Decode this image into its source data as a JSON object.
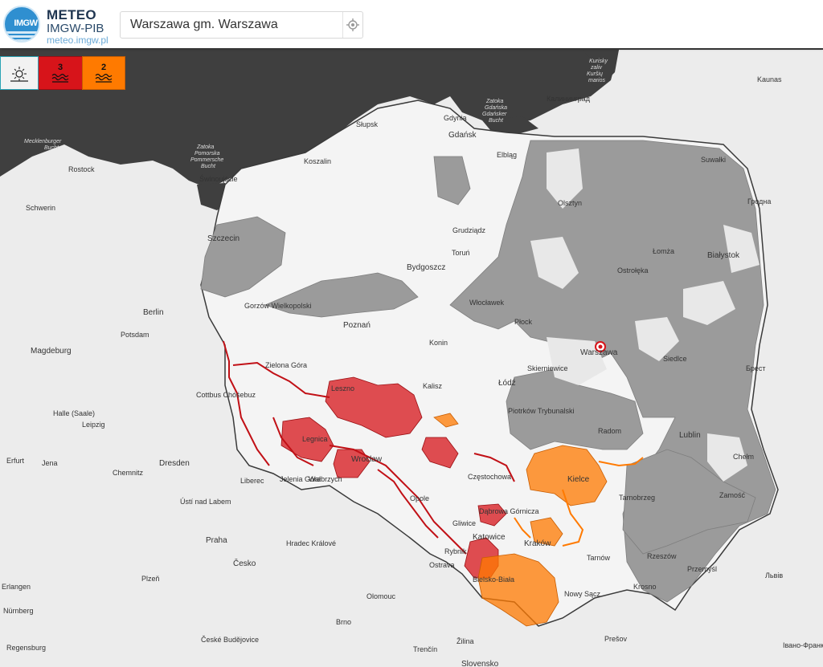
{
  "app": {
    "brand_title": "METEO",
    "brand_subtitle": "IMGW-PIB",
    "brand_url": "meteo.imgw.pl",
    "logo_text": "IMGW"
  },
  "search": {
    "value": "Warszawa gm. Warszawa",
    "placeholder": "Warszawa gm. Warszawa"
  },
  "warnings": {
    "sun_icon": "sun-icon",
    "red": {
      "level": "3",
      "icon": "wave-icon",
      "color": "#d7141a"
    },
    "orange": {
      "level": "2",
      "icon": "wave-icon",
      "color": "#ff7a00"
    }
  },
  "colors": {
    "sea": "#3f3f3f",
    "land_foreign": "#ececec",
    "land_poland": "#f3f3f3",
    "no_warning_grey": "#9b9b9b",
    "red_warning": "#d7141a",
    "orange_warning": "#ff7a00"
  },
  "map_labels": {
    "seas": [
      "Mecklenburger Bucht",
      "Zatoka Pomorska Pommersche Bucht",
      "Zatoka Gdańska Gdańsker Bucht",
      "Kurisky zaliv Kuršių marios"
    ],
    "cities": [
      "Rostock",
      "Schwerin",
      "Szczecin",
      "Świnoujście",
      "Słupsk",
      "Koszalin",
      "Gdynia",
      "Gdańsk",
      "Elbląg",
      "Калининград",
      "Kaunas",
      "Suwałki",
      "Olsztyn",
      "Grudziądz",
      "Toruń",
      "Bydgoszcz",
      "Łomża",
      "Białystok",
      "Гродна",
      "Ostrołęka",
      "Włocławek",
      "Płock",
      "Gorzów Wielkopolski",
      "Poznań",
      "Berlin",
      "Potsdam",
      "Magdeburg",
      "Konin",
      "Warszawa",
      "Siedlce",
      "Брест",
      "Zielona Góra",
      "Leszno",
      "Kalisz",
      "Łódź",
      "Skierniewice",
      "Cottbus Chóśebuz",
      "Halle (Saale)",
      "Leipzig",
      "Piotrków Trybunalski",
      "Radom",
      "Lublin",
      "Legnica",
      "Wrocław",
      "Chełm",
      "Erfurt",
      "Jena",
      "Dresden",
      "Chemnitz",
      "Liberec",
      "Jelenia Góra",
      "Wałbrzych",
      "Opole",
      "Częstochowa",
      "Kielce",
      "Tarnobrzeg",
      "Zamość",
      "Ústí nad Labem",
      "Gliwice",
      "Dąbrowa Górnicza",
      "Katowice",
      "Kraków",
      "Praha",
      "Hradec Králové",
      "Česko",
      "Rybnik",
      "Bielsko-Biała",
      "Tarnów",
      "Rzeszów",
      "Przemyśl",
      "Львів",
      "Ostrava",
      "Nowy Sącz",
      "Krosno",
      "Plzeň",
      "Olomouc",
      "Erlangen",
      "Nürnberg",
      "Brno",
      "Žilina",
      "České Budějovice",
      "Prešov",
      "Regensburg",
      "Trenčín",
      "Slovensko",
      "Івано-Франк"
    ]
  },
  "marker": {
    "city": "Warszawa",
    "icon": "location-pin-icon"
  }
}
